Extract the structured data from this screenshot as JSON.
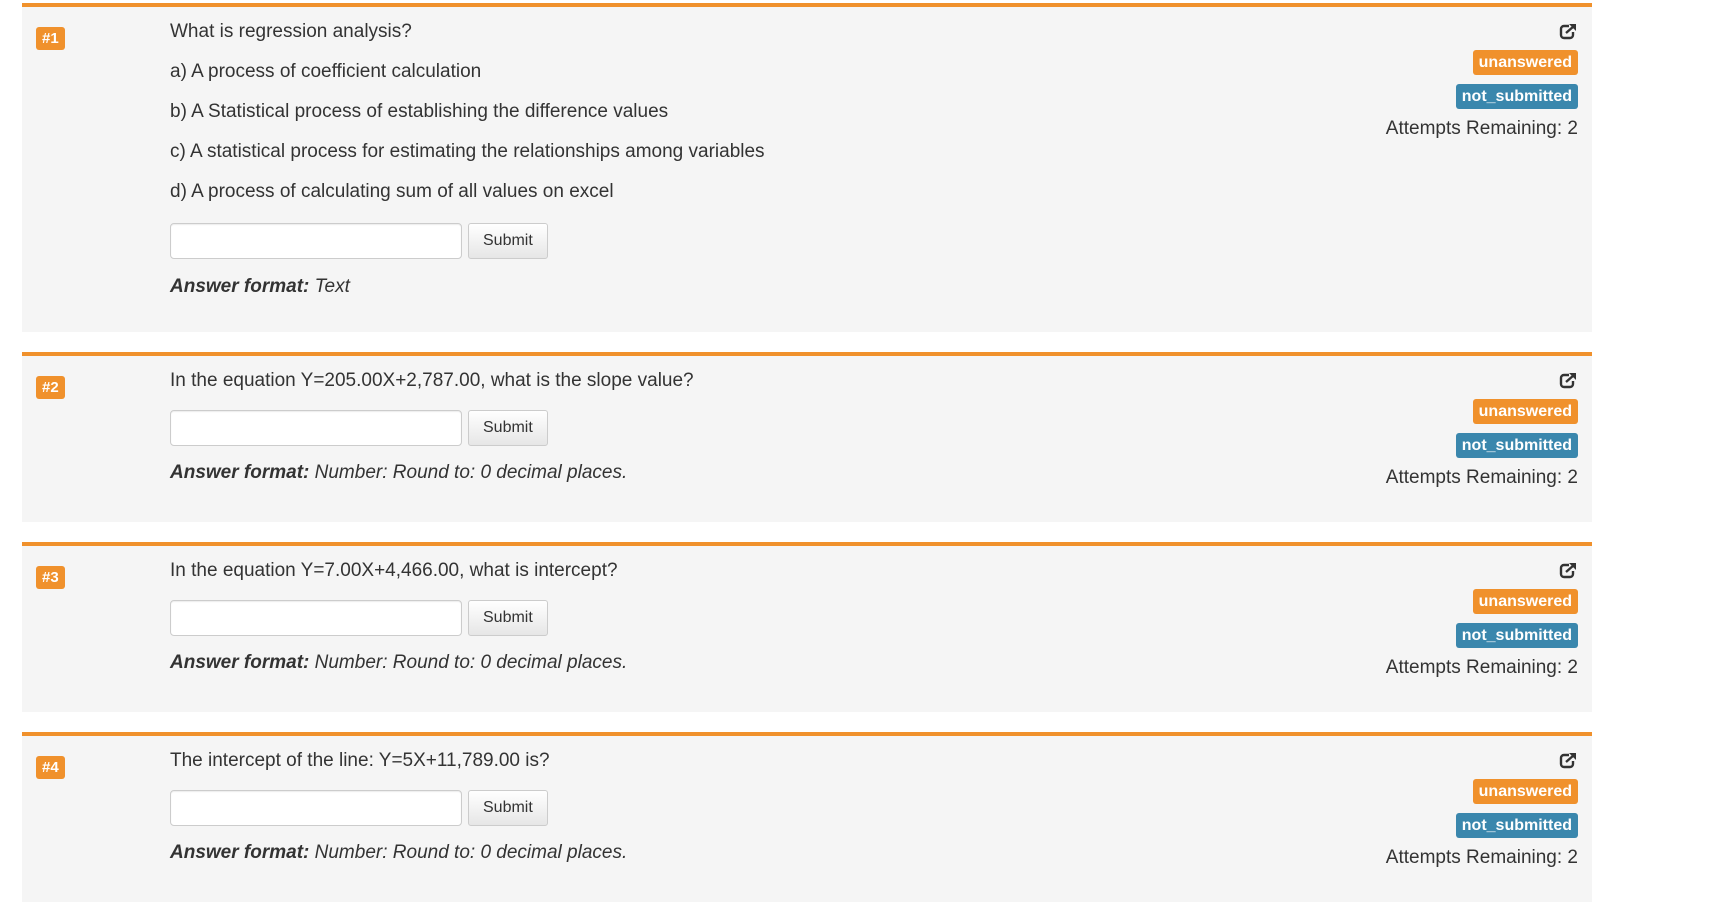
{
  "colors": {
    "accent": "#f0912c",
    "info": "#3a87ad",
    "panel": "#f5f5f5"
  },
  "share_icon": "share-icon",
  "questions": [
    {
      "number": "#1",
      "text": "What is regression analysis?",
      "options": [
        "a) A process of coefficient calculation",
        "b) A Statistical process of establishing the difference values",
        "c) A statistical process for estimating the relationships among variables",
        "d) A process of calculating sum of all values on excel"
      ],
      "input_value": "",
      "submit_label": "Submit",
      "format_label": "Answer format:",
      "format_value": "Text",
      "status": "unanswered",
      "submission": "not_submitted",
      "attempts": "Attempts Remaining: 2"
    },
    {
      "number": "#2",
      "text": "In the equation Y=205.00X+2,787.00, what is the slope value?",
      "options": [],
      "input_value": "",
      "submit_label": "Submit",
      "format_label": "Answer format:",
      "format_value": "Number: Round to: 0 decimal places.",
      "status": "unanswered",
      "submission": "not_submitted",
      "attempts": "Attempts Remaining: 2"
    },
    {
      "number": "#3",
      "text": "In the equation Y=7.00X+4,466.00, what is intercept?",
      "options": [],
      "input_value": "",
      "submit_label": "Submit",
      "format_label": "Answer format:",
      "format_value": "Number: Round to: 0 decimal places.",
      "status": "unanswered",
      "submission": "not_submitted",
      "attempts": "Attempts Remaining: 2"
    },
    {
      "number": "#4",
      "text": "The intercept of the line: Y=5X+11,789.00 is?",
      "options": [],
      "input_value": "",
      "submit_label": "Submit",
      "format_label": "Answer format:",
      "format_value": "Number: Round to: 0 decimal places.",
      "status": "unanswered",
      "submission": "not_submitted",
      "attempts": "Attempts Remaining: 2"
    }
  ]
}
